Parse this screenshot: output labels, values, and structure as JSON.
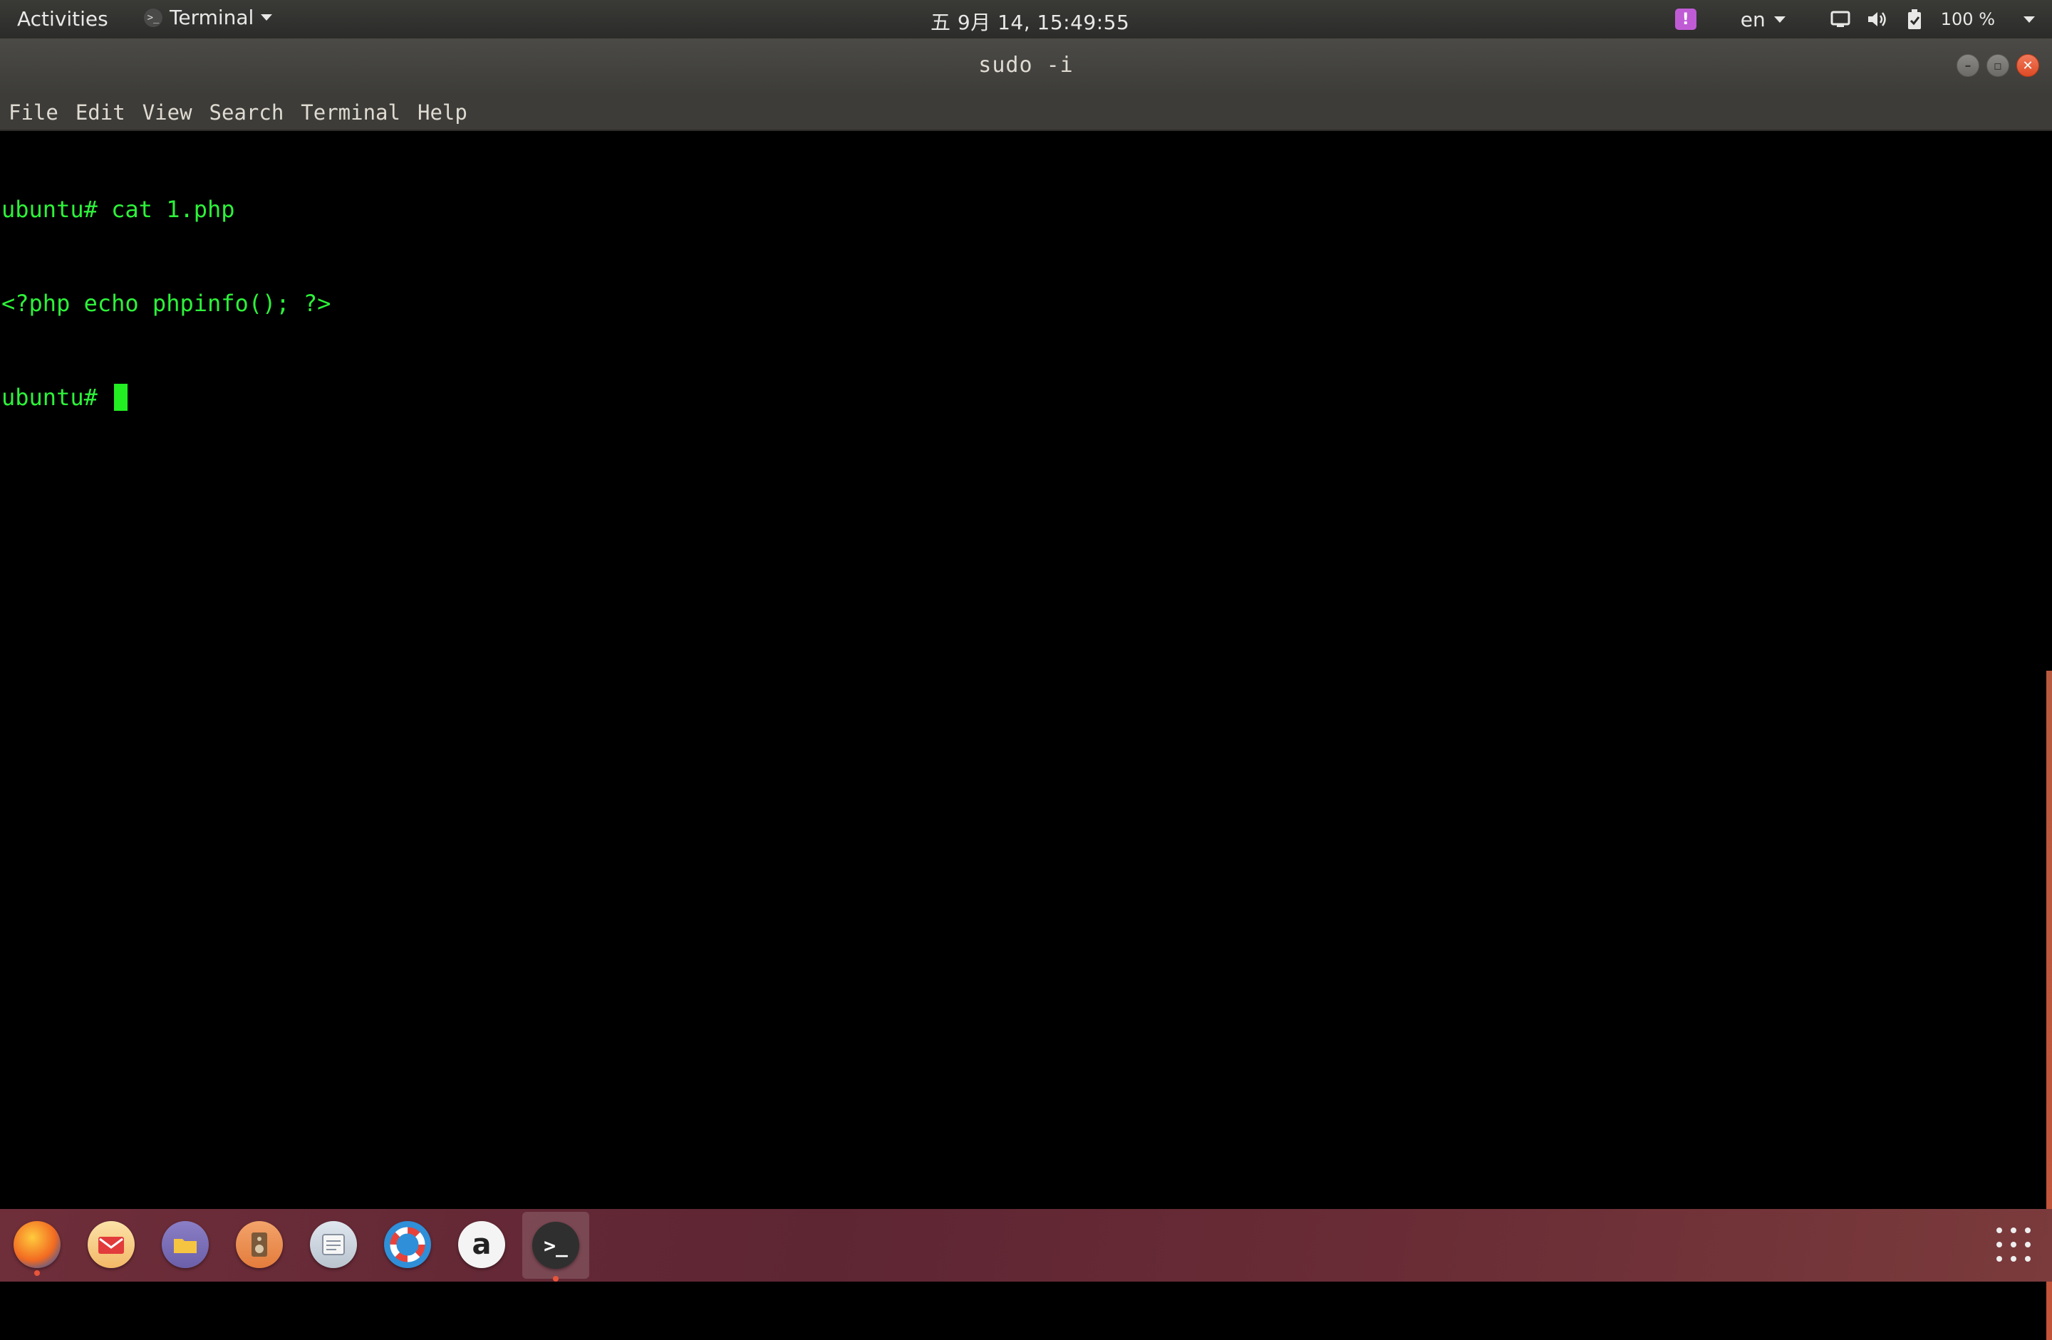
{
  "topbar": {
    "activities_label": "Activities",
    "app_menu_label": "Terminal",
    "clock": "五 9月 14, 15:49:55",
    "language": "en",
    "battery_percent": "100 %",
    "icons": [
      "alert-icon",
      "network-icon",
      "volume-icon",
      "battery-icon",
      "system-menu-chevron-icon"
    ]
  },
  "window": {
    "title": "sudo -i",
    "controls": [
      "minimize",
      "maximize",
      "close"
    ]
  },
  "menubar": {
    "items": [
      "File",
      "Edit",
      "View",
      "Search",
      "Terminal",
      "Help"
    ]
  },
  "terminal": {
    "lines": [
      "ubuntu# cat 1.php",
      "<?php echo phpinfo(); ?>",
      "ubuntu# "
    ],
    "text_color": "#2df23a",
    "background": "#000000"
  },
  "dock": {
    "items": [
      {
        "name": "firefox",
        "icon": "firefox-icon",
        "running": true
      },
      {
        "name": "mail",
        "icon": "mail-icon",
        "running": false
      },
      {
        "name": "files",
        "icon": "folder-icon",
        "running": false
      },
      {
        "name": "music",
        "icon": "speaker-icon",
        "running": false
      },
      {
        "name": "notes",
        "icon": "notes-icon",
        "running": false
      },
      {
        "name": "help",
        "icon": "lifebuoy-icon",
        "running": false
      },
      {
        "name": "amazon",
        "icon": "amazon-icon",
        "running": false
      },
      {
        "name": "terminal",
        "icon": "terminal-icon",
        "running": true,
        "active": true
      }
    ],
    "amazon_glyph": "a",
    "terminal_glyph": ">_"
  }
}
